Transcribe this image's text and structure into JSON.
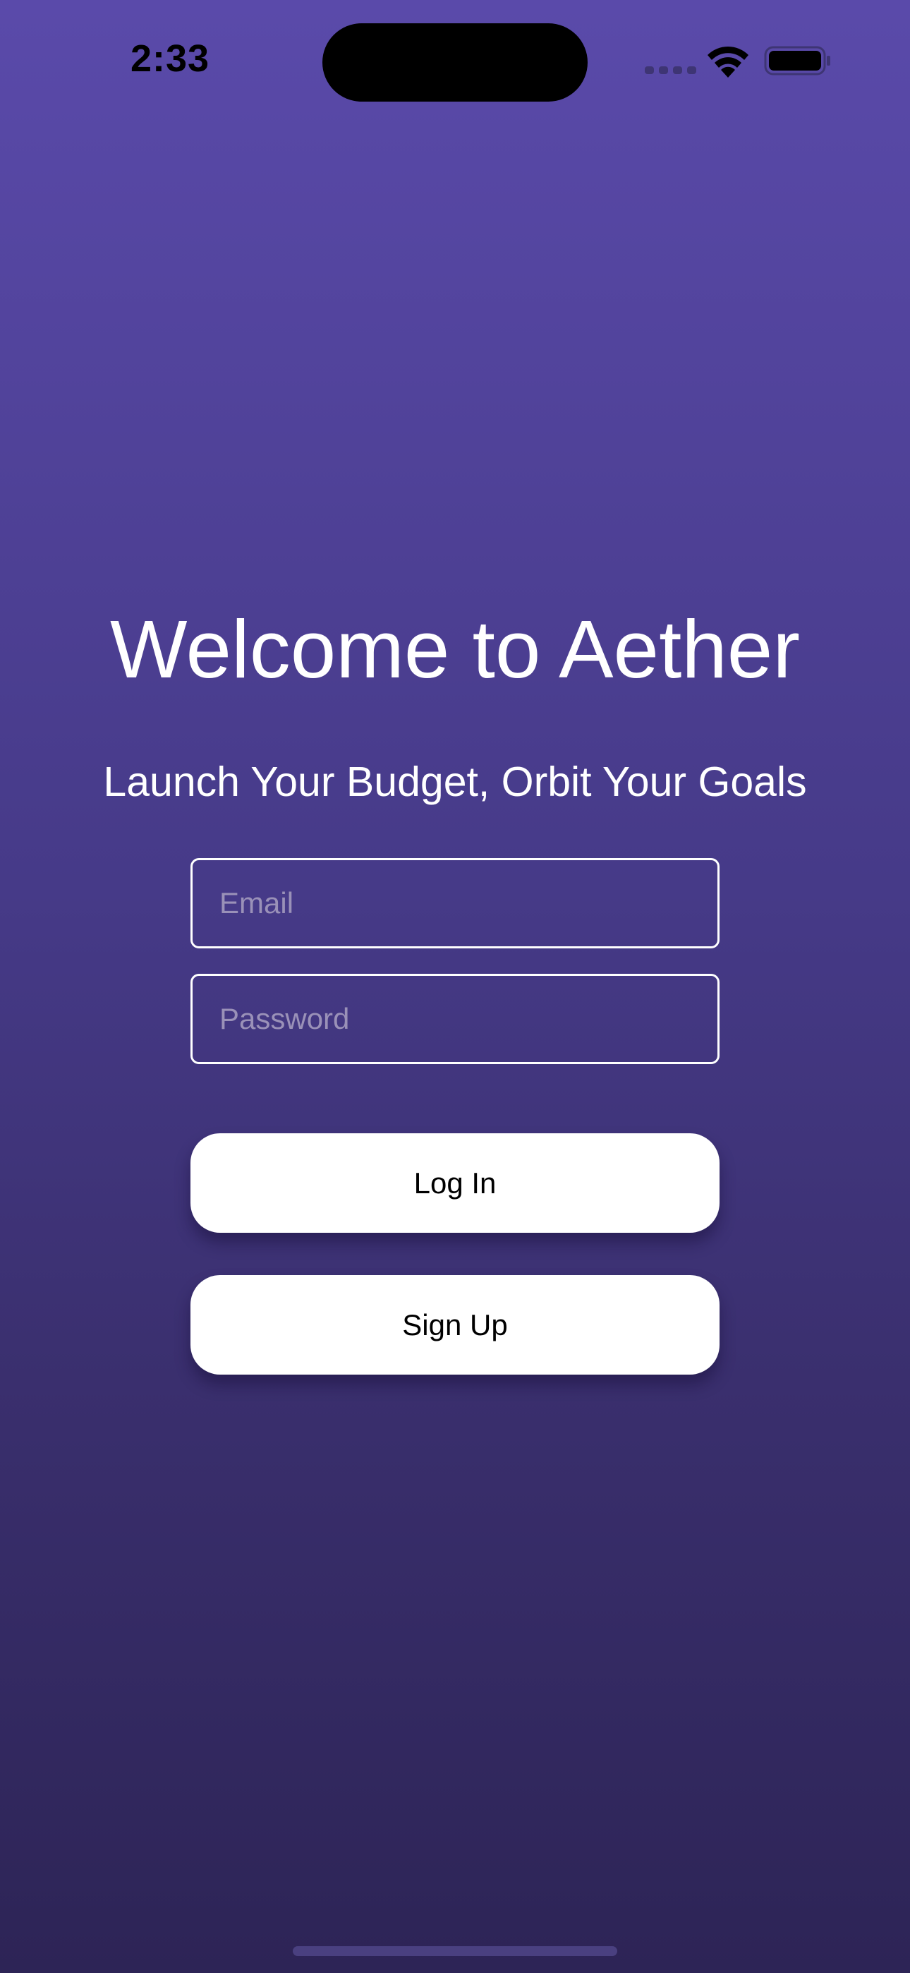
{
  "status_bar": {
    "time": "2:33",
    "icons": [
      "cellular-signal-icon",
      "wifi-icon",
      "battery-icon"
    ]
  },
  "welcome": {
    "title": "Welcome to Aether",
    "subtitle": "Launch Your Budget, Orbit Your Goals"
  },
  "form": {
    "email_placeholder": "Email",
    "password_placeholder": "Password",
    "email_value": "",
    "password_value": ""
  },
  "buttons": {
    "login_label": "Log In",
    "signup_label": "Sign Up"
  },
  "colors": {
    "background_top": "#5a4aaa",
    "background_bottom": "#2d2456",
    "text": "#ffffff",
    "button_background": "#ffffff",
    "button_text": "#000000",
    "placeholder": "#9a91b8"
  }
}
